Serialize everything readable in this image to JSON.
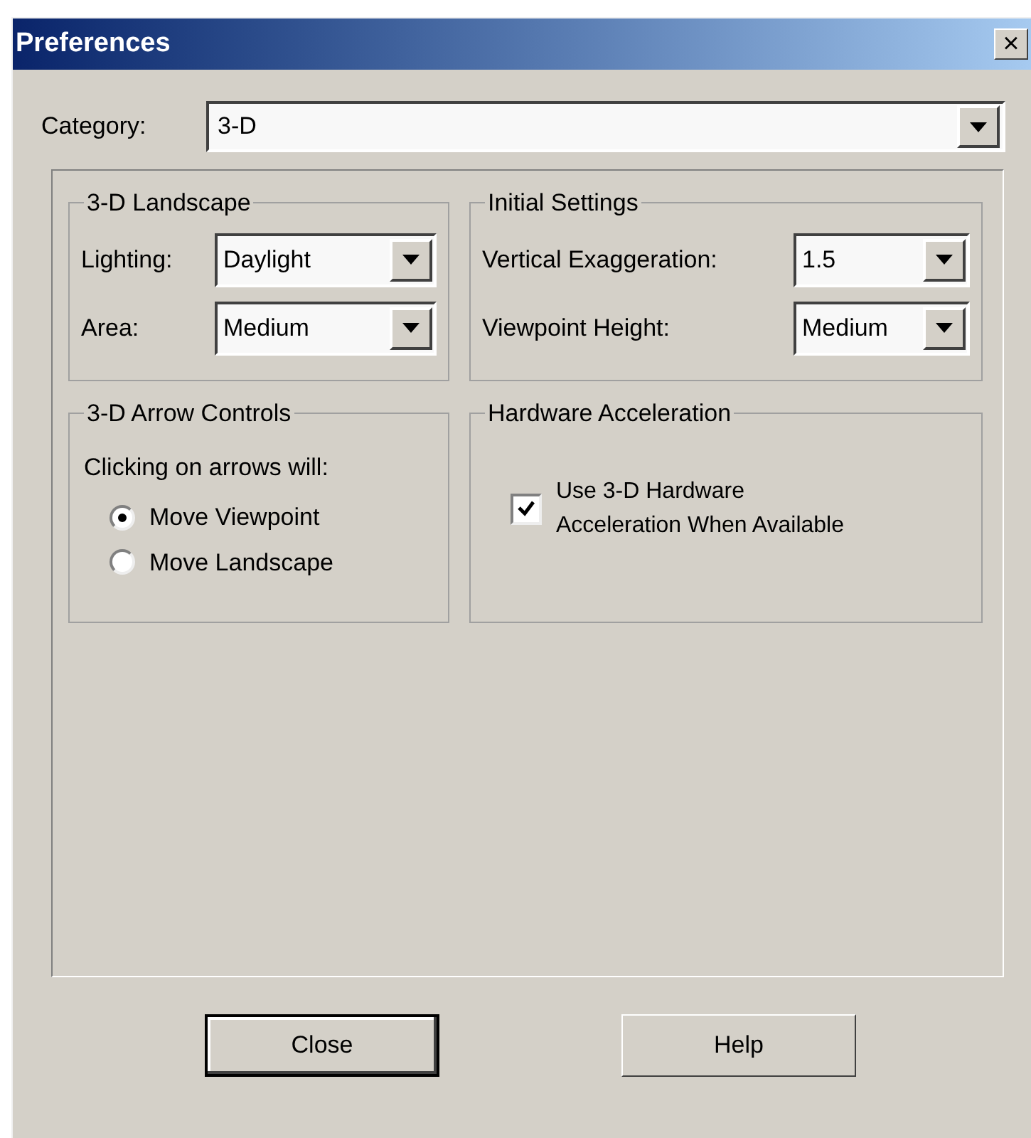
{
  "window": {
    "title": "Preferences",
    "close": "×"
  },
  "category": {
    "label": "Category:",
    "value": "3-D"
  },
  "groups": [
    {
      "kind": "dropdowns",
      "title": "3-D Landscape",
      "fields": [
        {
          "label": "Lighting:",
          "value": "Daylight"
        },
        {
          "label": "Area:",
          "value": "Medium"
        }
      ]
    },
    {
      "kind": "dropdowns",
      "title": "Initial Settings",
      "fields": [
        {
          "label": "Vertical Exaggeration:",
          "value": "1.5"
        },
        {
          "label": "Viewpoint Height:",
          "value": "Medium"
        }
      ]
    },
    {
      "kind": "radios",
      "title": "3-D Arrow Controls",
      "prompt": "Clicking on arrows will:",
      "options": [
        {
          "label": "Move Viewpoint",
          "selected": true
        },
        {
          "label": "Move Landscape",
          "selected": false
        }
      ]
    },
    {
      "kind": "checkbox",
      "title": "Hardware Acceleration",
      "checkbox": {
        "label": "Use 3-D Hardware Acceleration When Available",
        "checked": true
      }
    }
  ],
  "buttons": [
    {
      "label": "Close",
      "default": true
    },
    {
      "label": "Help",
      "default": false
    }
  ]
}
